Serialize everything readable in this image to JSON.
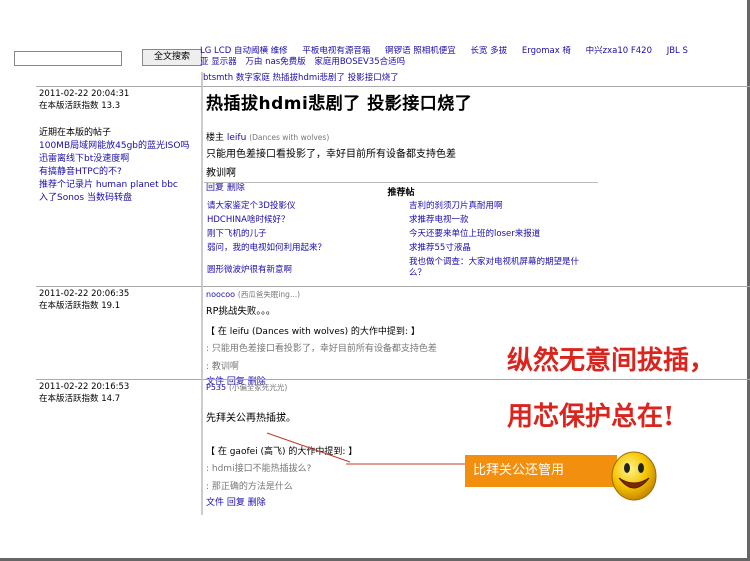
{
  "header": {
    "search_button": "全文搜索",
    "nav_row1": [
      "LG LCD 自动阈横 维修",
      "平板电视有源音箱",
      "锕锣语 照相机便宜",
      "长宽 多拔",
      "Ergomax 椅",
      "中兴zxa10 F420",
      "JBL S"
    ],
    "nav_row2": [
      "亚 显示器",
      "万由 nas免费版",
      "家庭用BOSEV35合适吗"
    ]
  },
  "thread": {
    "breadcrumb": "btsmth 数字家庭 热插拔hdmi悲剧了 投影接口烧了",
    "posts": [
      {
        "date": "2011-02-22 20:04:31",
        "score": "在本版活跃指数 13.3",
        "title": "热插拔hdmi悲剧了 投影接口烧了",
        "author_label": "楼主",
        "author": "leifu",
        "author_nick": "(Dances with wolves)",
        "body1": "只能用色差接口看投影了，幸好目前所有设备都支持色差",
        "body2": "教训啊",
        "actions": [
          "回复",
          "删除"
        ],
        "recent_header": "近期在本版的帖子",
        "recent": [
          "100MB局域网能放45gb的蓝光ISO吗",
          "迅雷离线下bt没速度啊",
          "有搞静音HTPC的不?",
          "推荐个记录片 human planet bbc",
          "入了Sonos 当数码转盘"
        ],
        "recommend_title": "推荐帖",
        "recommend_left": [
          "请大家鉴定个3D投影仪",
          "HDCHINA啥时候好？",
          "刚下飞机的儿子",
          "弱问，我的电视如何利用起来？",
          "",
          "圆形微波炉很有新意啊"
        ],
        "recommend_right": [
          "吉利的刹须刀片真耐用啊",
          "求推荐电视一款",
          "今天还要来单位上班的loser来报道",
          "求推荐55寸液晶",
          "我也做个调查：大家对电视机屏幕的期望是什么？"
        ]
      },
      {
        "date": "2011-02-22 20:06:35",
        "score": "在本版活跃指数 19.1",
        "author": "noocoo",
        "author_nick": "(西瓜爸失眠ing...)",
        "body1": "RP挑战失败。。。",
        "quote_head": "【 在 leifu (Dances with wolves) 的大作中提到: 】",
        "quote1": ": 只能用色差接口看投影了，幸好目前所有设备都支持色差",
        "quote2": ": 教训啊",
        "actions": [
          "文件",
          "回复",
          "删除"
        ]
      },
      {
        "date": "2011-02-22 20:16:53",
        "score": "在本版活跃指数 14.7",
        "author": "P535",
        "author_nick": "(小偏全家死光光)",
        "body1": "先拜关公再热插拔。",
        "quote_head": "【 在 gaofei (高飞) 的大作中提到: 】",
        "quote1": ": hdmi接口不能热插拔么?",
        "quote2": ": 那正确的方法是什么",
        "actions": [
          "文件",
          "回复",
          "删除"
        ]
      }
    ]
  },
  "overlay": {
    "line1": "纵然无意间拔插，",
    "line2": "用芯保护总在!",
    "callout": "比拜关公还管用"
  },
  "colors": {
    "link": "#1a0dab",
    "red": "#d9251d",
    "orange": "#f28f0e"
  }
}
